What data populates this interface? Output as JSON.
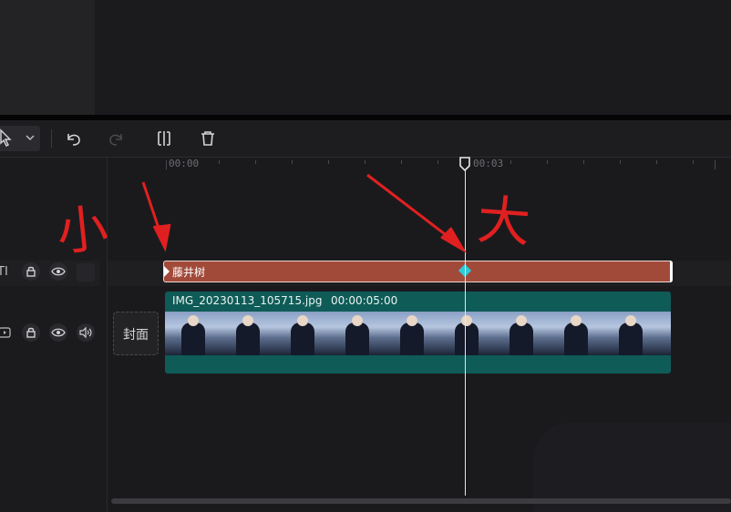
{
  "toolbar": {
    "tools": [
      {
        "name": "select-tool",
        "icon": "cursor-icon"
      },
      {
        "name": "undo",
        "icon": "undo-icon"
      },
      {
        "name": "redo",
        "icon": "redo-icon"
      },
      {
        "name": "split",
        "icon": "split-icon"
      },
      {
        "name": "delete",
        "icon": "trash-icon"
      }
    ]
  },
  "timeline": {
    "ruler": {
      "start": "00:00",
      "playhead_time": "00:03"
    },
    "text_track": {
      "head_label": "TI",
      "clip_label": "藤井树",
      "clip_color": "#a24a3a"
    },
    "video_track": {
      "clip_filename": "IMG_20230113_105715.jpg",
      "clip_duration": "00:00:05:00",
      "clip_color": "#0f5b57",
      "cover_label": "封面"
    },
    "accent_color": "#2ec9d9"
  },
  "annotations": {
    "left_text": "小",
    "right_text": "大",
    "color": "#e02020"
  }
}
